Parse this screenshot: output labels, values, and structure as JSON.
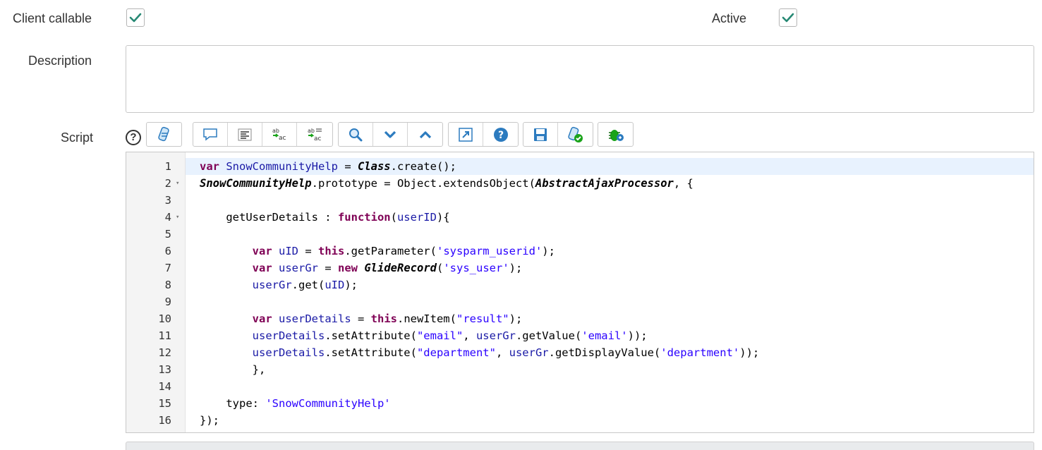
{
  "form": {
    "client_callable": {
      "label": "Client callable",
      "checked": true
    },
    "active": {
      "label": "Active",
      "checked": true
    },
    "description": {
      "label": "Description",
      "value": ""
    },
    "script": {
      "label": "Script",
      "help": "?"
    }
  },
  "toolbar": {
    "groups": [
      [
        "script-include-icon"
      ],
      [
        "comment-icon",
        "format-code-icon",
        "replace-icon",
        "replace-all-icon"
      ],
      [
        "search-icon",
        "next-icon",
        "previous-icon"
      ],
      [
        "fullscreen-icon",
        "help-icon"
      ],
      [
        "save-icon",
        "syntax-check-icon"
      ],
      [
        "debug-icon"
      ]
    ]
  },
  "editor": {
    "active_line": 1,
    "lines": [
      {
        "n": "1",
        "fold": false
      },
      {
        "n": "2",
        "fold": true
      },
      {
        "n": "3",
        "fold": false
      },
      {
        "n": "4",
        "fold": true
      },
      {
        "n": "5",
        "fold": false
      },
      {
        "n": "6",
        "fold": false
      },
      {
        "n": "7",
        "fold": false
      },
      {
        "n": "8",
        "fold": false
      },
      {
        "n": "9",
        "fold": false
      },
      {
        "n": "10",
        "fold": false
      },
      {
        "n": "11",
        "fold": false
      },
      {
        "n": "12",
        "fold": false
      },
      {
        "n": "13",
        "fold": false
      },
      {
        "n": "14",
        "fold": false
      },
      {
        "n": "15",
        "fold": false
      },
      {
        "n": "16",
        "fold": false
      }
    ],
    "code": [
      [
        [
          "kw",
          "var"
        ],
        [
          "t",
          " "
        ],
        [
          "vr",
          "SnowCommunityHelp"
        ],
        [
          "t",
          " = "
        ],
        [
          "cl",
          "Class"
        ],
        [
          "t",
          ".create();"
        ]
      ],
      [
        [
          "cl",
          "SnowCommunityHelp"
        ],
        [
          "t",
          ".prototype = Object.extendsObject("
        ],
        [
          "cl",
          "AbstractAjaxProcessor"
        ],
        [
          "t",
          ", {"
        ]
      ],
      [],
      [
        [
          "t",
          "    getUserDetails : "
        ],
        [
          "kw",
          "function"
        ],
        [
          "t",
          "("
        ],
        [
          "vr",
          "userID"
        ],
        [
          "t",
          "){"
        ]
      ],
      [],
      [
        [
          "t",
          "        "
        ],
        [
          "kw",
          "var"
        ],
        [
          "t",
          " "
        ],
        [
          "vr",
          "uID"
        ],
        [
          "t",
          " = "
        ],
        [
          "kw",
          "this"
        ],
        [
          "t",
          ".getParameter("
        ],
        [
          "st",
          "'sysparm_userid'"
        ],
        [
          "t",
          ");"
        ]
      ],
      [
        [
          "t",
          "        "
        ],
        [
          "kw",
          "var"
        ],
        [
          "t",
          " "
        ],
        [
          "vr",
          "userGr"
        ],
        [
          "t",
          " = "
        ],
        [
          "kw",
          "new"
        ],
        [
          "t",
          " "
        ],
        [
          "cl",
          "GlideRecord"
        ],
        [
          "t",
          "("
        ],
        [
          "st",
          "'sys_user'"
        ],
        [
          "t",
          ");"
        ]
      ],
      [
        [
          "t",
          "        "
        ],
        [
          "vr",
          "userGr"
        ],
        [
          "t",
          ".get("
        ],
        [
          "vr",
          "uID"
        ],
        [
          "t",
          ");"
        ]
      ],
      [],
      [
        [
          "t",
          "        "
        ],
        [
          "kw",
          "var"
        ],
        [
          "t",
          " "
        ],
        [
          "vr",
          "userDetails"
        ],
        [
          "t",
          " = "
        ],
        [
          "kw",
          "this"
        ],
        [
          "t",
          ".newItem("
        ],
        [
          "st",
          "\"result\""
        ],
        [
          "t",
          ");"
        ]
      ],
      [
        [
          "t",
          "        "
        ],
        [
          "vr",
          "userDetails"
        ],
        [
          "t",
          ".setAttribute("
        ],
        [
          "st",
          "\"email\""
        ],
        [
          "t",
          ", "
        ],
        [
          "vr",
          "userGr"
        ],
        [
          "t",
          ".getValue("
        ],
        [
          "st",
          "'email'"
        ],
        [
          "t",
          "));"
        ]
      ],
      [
        [
          "t",
          "        "
        ],
        [
          "vr",
          "userDetails"
        ],
        [
          "t",
          ".setAttribute("
        ],
        [
          "st",
          "\"department\""
        ],
        [
          "t",
          ", "
        ],
        [
          "vr",
          "userGr"
        ],
        [
          "t",
          ".getDisplayValue("
        ],
        [
          "st",
          "'department'"
        ],
        [
          "t",
          "));"
        ]
      ],
      [
        [
          "t",
          "        },"
        ]
      ],
      [],
      [
        [
          "t",
          "    type: "
        ],
        [
          "st",
          "'SnowCommunityHelp'"
        ]
      ],
      [
        [
          "t",
          "});"
        ]
      ]
    ]
  }
}
